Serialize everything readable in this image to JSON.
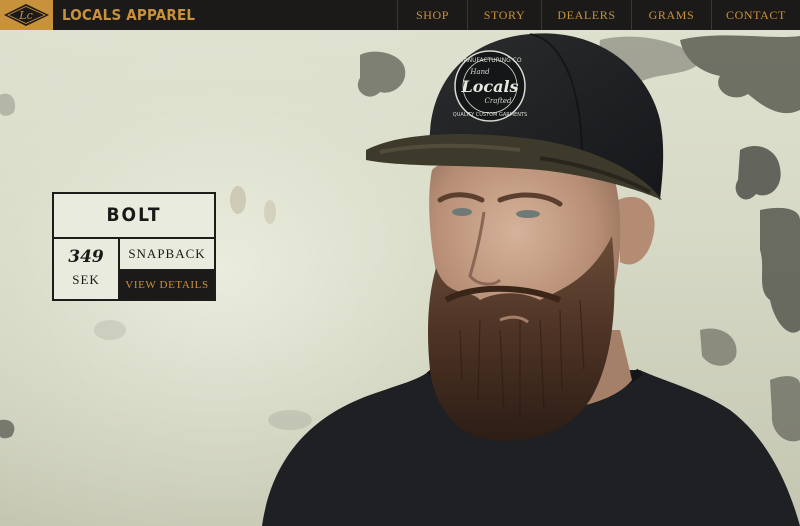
{
  "brand": {
    "name": "LOCALS APPAREL",
    "logo_letters": "Lc"
  },
  "nav": [
    {
      "label": "SHOP"
    },
    {
      "label": "STORY"
    },
    {
      "label": "DEALERS"
    },
    {
      "label": "GRAMS"
    },
    {
      "label": "CONTACT"
    }
  ],
  "product": {
    "name": "BOLT",
    "price": "349",
    "currency": "SEK",
    "type": "SNAPBACK",
    "cta": "VIEW DETAILS"
  },
  "cap_patch": {
    "top_text": "MANUFACTURING CO",
    "script_small": "Hand",
    "script_main": "Locals",
    "script_sub": "Crafted",
    "bottom_text": "QUALITY CUSTOM GARMENTS"
  },
  "colors": {
    "accent_gold": "#c8913b",
    "nav_bg": "#1c1a19",
    "card_bg": "#e9ebde",
    "wall": "#d8dbc8"
  }
}
